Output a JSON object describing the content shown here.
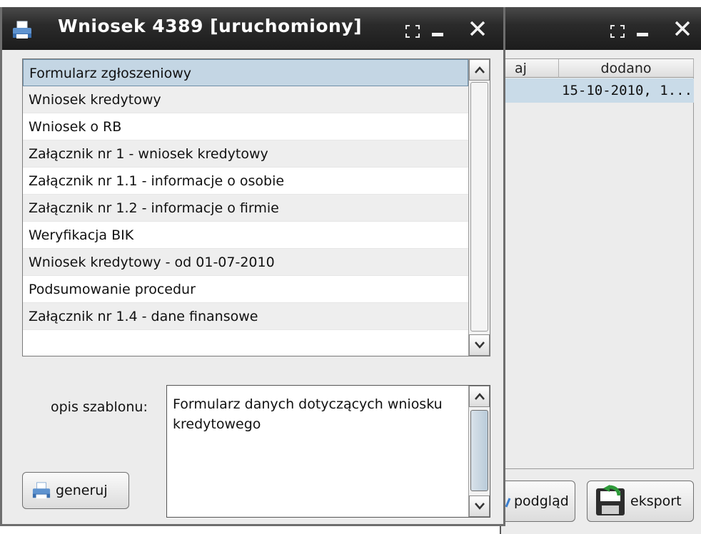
{
  "dialog": {
    "title": "Wniosek 4389 [uruchomiony]",
    "items": [
      "Formularz zgłoszeniowy",
      "Wniosek kredytowy",
      "Wniosek o RB",
      "Załącznik nr 1 - wniosek kredytowy",
      "Załącznik nr 1.1 - informacje o osobie",
      "Załącznik nr 1.2 - informacje o firmie",
      "Weryfikacja BIK",
      "Wniosek kredytowy - od 01-07-2010",
      "Podsumowanie procedur",
      "Załącznik nr 1.4 - dane finansowe"
    ],
    "selected_index": 0,
    "opis_label": "opis szablonu:",
    "opis_text": "Formularz danych dotyczących wniosku kredytowego",
    "generuj_label": "generuj"
  },
  "background_window": {
    "col_partial": "aj",
    "col_dodano": "dodano",
    "cell_dodano": "15-10-2010, 1...",
    "podglad_label": "podgląd",
    "eksport_label": "eksport"
  },
  "colors": {
    "titlebar": "#1c1c1c",
    "selection": "#c4d6e4",
    "window_bg": "#ececec"
  },
  "icons": [
    "printer-icon",
    "maximize-icon",
    "minimize-icon",
    "close-icon",
    "scroll-up-icon",
    "scroll-down-icon",
    "save-arrow-icon"
  ]
}
